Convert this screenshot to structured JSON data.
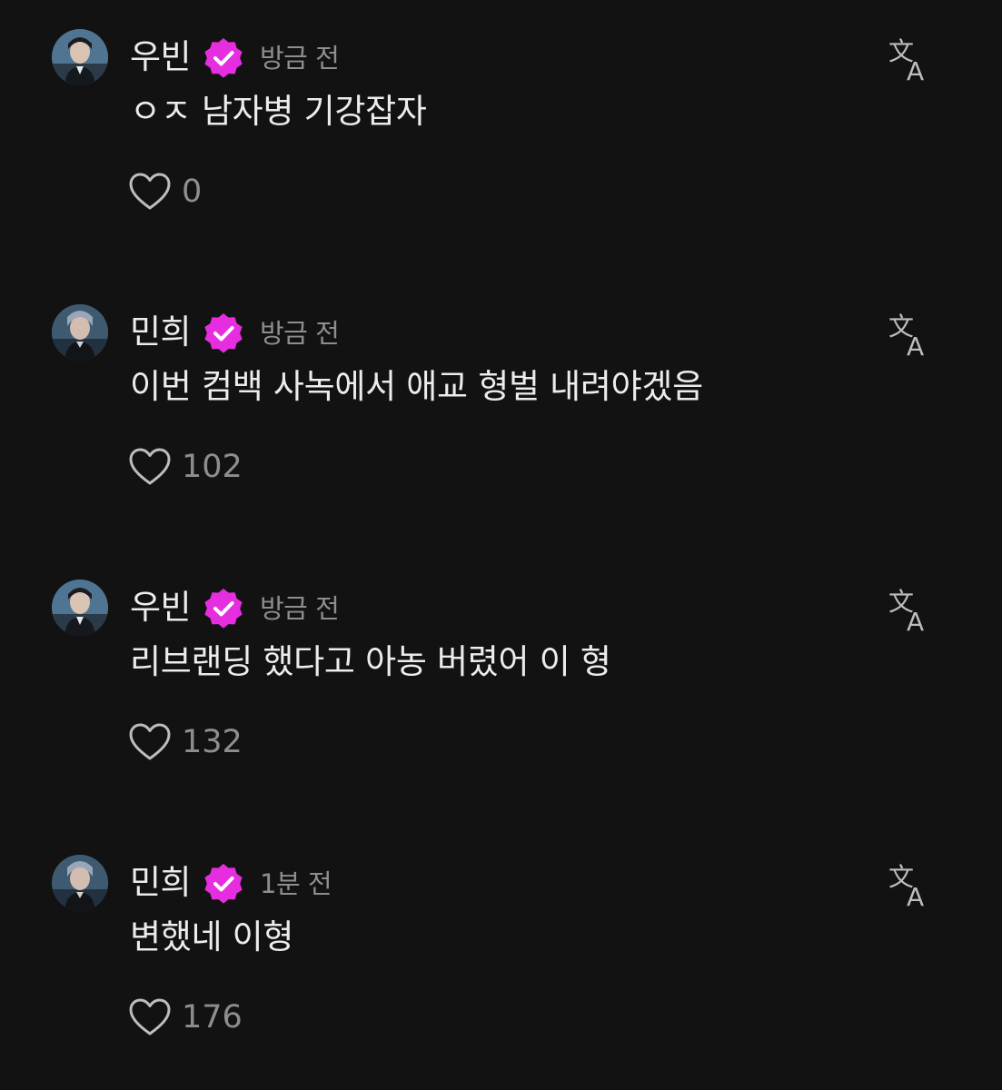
{
  "colors": {
    "background": "#121212",
    "text": "#ececec",
    "muted": "#8e8e8e",
    "badge": "#e62ee0"
  },
  "icons": {
    "verified": "verified-badge-icon",
    "translate": "translate-icon",
    "like": "heart-outline-icon"
  },
  "comments": [
    {
      "username": "우빈",
      "timestamp": "방금 전",
      "text": "ㅇㅈ 남자병 기강잡자",
      "likes": "0"
    },
    {
      "username": "민희",
      "timestamp": "방금 전",
      "text": "이번 컴백 사녹에서 애교 형벌 내려야겠음",
      "likes": "102"
    },
    {
      "username": "우빈",
      "timestamp": "방금 전",
      "text": "리브랜딩 했다고 아농 버렸어 이 형",
      "likes": "132"
    },
    {
      "username": "민희",
      "timestamp": "1분 전",
      "text": "변했네 이형",
      "likes": "176"
    }
  ]
}
